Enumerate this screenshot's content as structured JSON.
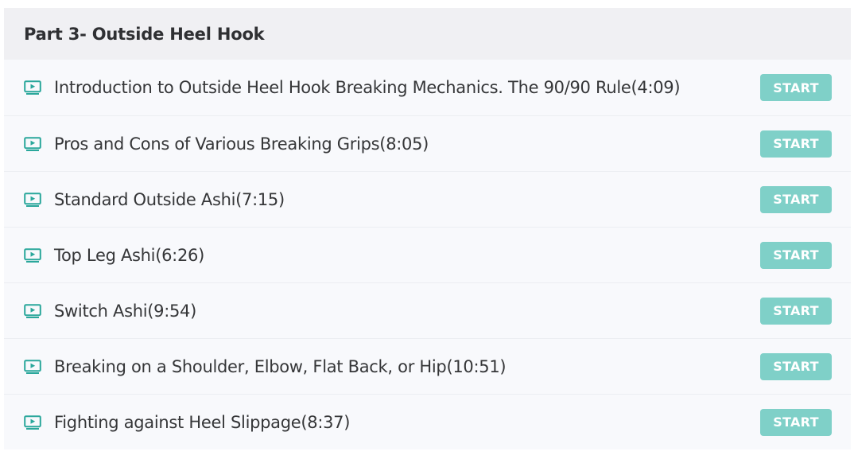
{
  "section": {
    "title": "Part 3- Outside Heel Hook"
  },
  "colors": {
    "accent": "#7fd0c8",
    "icon": "#2aa79b",
    "header_bg": "#f0f0f3",
    "row_bg": "#f8f9fc"
  },
  "lectures": [
    {
      "icon": "video-play-icon",
      "title": "Introduction to Outside Heel Hook Breaking Mechanics. The 90/90 Rule(4:09)",
      "button": "START"
    },
    {
      "icon": "video-play-icon",
      "title": "Pros and Cons of Various Breaking Grips(8:05)",
      "button": "START"
    },
    {
      "icon": "video-play-icon",
      "title": "Standard Outside Ashi(7:15)",
      "button": "START"
    },
    {
      "icon": "video-play-icon",
      "title": "Top Leg Ashi(6:26)",
      "button": "START"
    },
    {
      "icon": "video-play-icon",
      "title": "Switch Ashi(9:54)",
      "button": "START"
    },
    {
      "icon": "video-play-icon",
      "title": "Breaking on a Shoulder, Elbow, Flat Back, or Hip(10:51)",
      "button": "START"
    },
    {
      "icon": "video-play-icon",
      "title": "Fighting against Heel Slippage(8:37)",
      "button": "START"
    }
  ]
}
